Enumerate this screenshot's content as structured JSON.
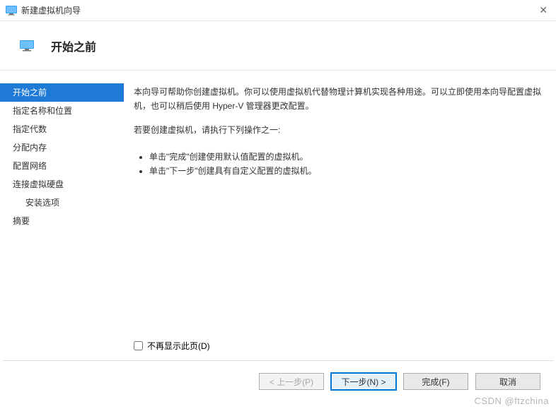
{
  "window": {
    "title": "新建虚拟机向导"
  },
  "header": {
    "title": "开始之前"
  },
  "sidebar": {
    "items": [
      {
        "label": "开始之前",
        "selected": true,
        "indent": false
      },
      {
        "label": "指定名称和位置",
        "selected": false,
        "indent": false
      },
      {
        "label": "指定代数",
        "selected": false,
        "indent": false
      },
      {
        "label": "分配内存",
        "selected": false,
        "indent": false
      },
      {
        "label": "配置网络",
        "selected": false,
        "indent": false
      },
      {
        "label": "连接虚拟硬盘",
        "selected": false,
        "indent": false
      },
      {
        "label": "安装选项",
        "selected": false,
        "indent": true
      },
      {
        "label": "摘要",
        "selected": false,
        "indent": false
      }
    ]
  },
  "main": {
    "intro": "本向导可帮助你创建虚拟机。你可以使用虚拟机代替物理计算机实现各种用途。可以立即使用本向导配置虚拟机，也可以稍后使用 Hyper-V 管理器更改配置。",
    "subhead": "若要创建虚拟机，请执行下列操作之一:",
    "bullets": [
      "单击\"完成\"创建使用默认值配置的虚拟机。",
      "单击\"下一步\"创建具有自定义配置的虚拟机。"
    ],
    "skip_label": "不再显示此页(D)"
  },
  "buttons": {
    "prev": "< 上一步(P)",
    "next": "下一步(N) >",
    "finish": "完成(F)",
    "cancel": "取消"
  },
  "watermark": "CSDN @ftzchina"
}
